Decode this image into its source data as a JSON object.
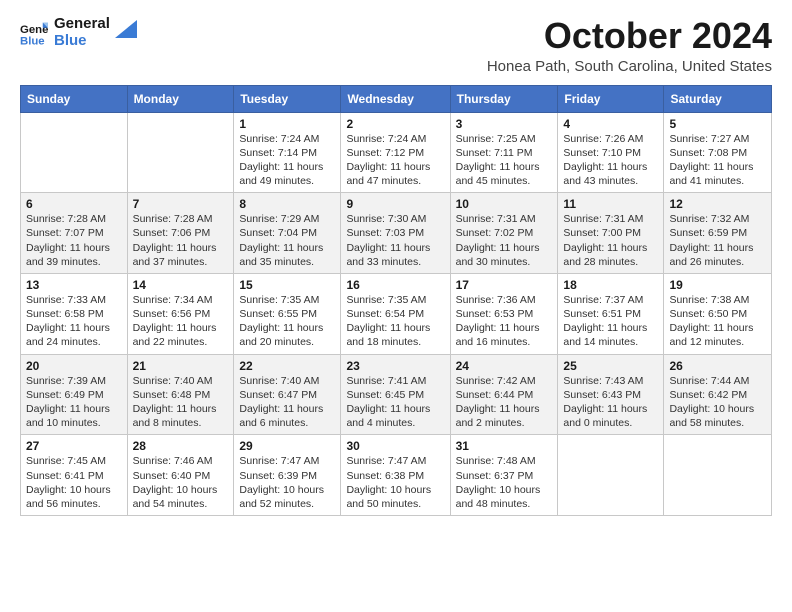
{
  "logo": {
    "line1": "General",
    "line2": "Blue"
  },
  "title": "October 2024",
  "location": "Honea Path, South Carolina, United States",
  "days_of_week": [
    "Sunday",
    "Monday",
    "Tuesday",
    "Wednesday",
    "Thursday",
    "Friday",
    "Saturday"
  ],
  "weeks": [
    [
      {
        "day": "",
        "info": ""
      },
      {
        "day": "",
        "info": ""
      },
      {
        "day": "1",
        "info": "Sunrise: 7:24 AM\nSunset: 7:14 PM\nDaylight: 11 hours and 49 minutes."
      },
      {
        "day": "2",
        "info": "Sunrise: 7:24 AM\nSunset: 7:12 PM\nDaylight: 11 hours and 47 minutes."
      },
      {
        "day": "3",
        "info": "Sunrise: 7:25 AM\nSunset: 7:11 PM\nDaylight: 11 hours and 45 minutes."
      },
      {
        "day": "4",
        "info": "Sunrise: 7:26 AM\nSunset: 7:10 PM\nDaylight: 11 hours and 43 minutes."
      },
      {
        "day": "5",
        "info": "Sunrise: 7:27 AM\nSunset: 7:08 PM\nDaylight: 11 hours and 41 minutes."
      }
    ],
    [
      {
        "day": "6",
        "info": "Sunrise: 7:28 AM\nSunset: 7:07 PM\nDaylight: 11 hours and 39 minutes."
      },
      {
        "day": "7",
        "info": "Sunrise: 7:28 AM\nSunset: 7:06 PM\nDaylight: 11 hours and 37 minutes."
      },
      {
        "day": "8",
        "info": "Sunrise: 7:29 AM\nSunset: 7:04 PM\nDaylight: 11 hours and 35 minutes."
      },
      {
        "day": "9",
        "info": "Sunrise: 7:30 AM\nSunset: 7:03 PM\nDaylight: 11 hours and 33 minutes."
      },
      {
        "day": "10",
        "info": "Sunrise: 7:31 AM\nSunset: 7:02 PM\nDaylight: 11 hours and 30 minutes."
      },
      {
        "day": "11",
        "info": "Sunrise: 7:31 AM\nSunset: 7:00 PM\nDaylight: 11 hours and 28 minutes."
      },
      {
        "day": "12",
        "info": "Sunrise: 7:32 AM\nSunset: 6:59 PM\nDaylight: 11 hours and 26 minutes."
      }
    ],
    [
      {
        "day": "13",
        "info": "Sunrise: 7:33 AM\nSunset: 6:58 PM\nDaylight: 11 hours and 24 minutes."
      },
      {
        "day": "14",
        "info": "Sunrise: 7:34 AM\nSunset: 6:56 PM\nDaylight: 11 hours and 22 minutes."
      },
      {
        "day": "15",
        "info": "Sunrise: 7:35 AM\nSunset: 6:55 PM\nDaylight: 11 hours and 20 minutes."
      },
      {
        "day": "16",
        "info": "Sunrise: 7:35 AM\nSunset: 6:54 PM\nDaylight: 11 hours and 18 minutes."
      },
      {
        "day": "17",
        "info": "Sunrise: 7:36 AM\nSunset: 6:53 PM\nDaylight: 11 hours and 16 minutes."
      },
      {
        "day": "18",
        "info": "Sunrise: 7:37 AM\nSunset: 6:51 PM\nDaylight: 11 hours and 14 minutes."
      },
      {
        "day": "19",
        "info": "Sunrise: 7:38 AM\nSunset: 6:50 PM\nDaylight: 11 hours and 12 minutes."
      }
    ],
    [
      {
        "day": "20",
        "info": "Sunrise: 7:39 AM\nSunset: 6:49 PM\nDaylight: 11 hours and 10 minutes."
      },
      {
        "day": "21",
        "info": "Sunrise: 7:40 AM\nSunset: 6:48 PM\nDaylight: 11 hours and 8 minutes."
      },
      {
        "day": "22",
        "info": "Sunrise: 7:40 AM\nSunset: 6:47 PM\nDaylight: 11 hours and 6 minutes."
      },
      {
        "day": "23",
        "info": "Sunrise: 7:41 AM\nSunset: 6:45 PM\nDaylight: 11 hours and 4 minutes."
      },
      {
        "day": "24",
        "info": "Sunrise: 7:42 AM\nSunset: 6:44 PM\nDaylight: 11 hours and 2 minutes."
      },
      {
        "day": "25",
        "info": "Sunrise: 7:43 AM\nSunset: 6:43 PM\nDaylight: 11 hours and 0 minutes."
      },
      {
        "day": "26",
        "info": "Sunrise: 7:44 AM\nSunset: 6:42 PM\nDaylight: 10 hours and 58 minutes."
      }
    ],
    [
      {
        "day": "27",
        "info": "Sunrise: 7:45 AM\nSunset: 6:41 PM\nDaylight: 10 hours and 56 minutes."
      },
      {
        "day": "28",
        "info": "Sunrise: 7:46 AM\nSunset: 6:40 PM\nDaylight: 10 hours and 54 minutes."
      },
      {
        "day": "29",
        "info": "Sunrise: 7:47 AM\nSunset: 6:39 PM\nDaylight: 10 hours and 52 minutes."
      },
      {
        "day": "30",
        "info": "Sunrise: 7:47 AM\nSunset: 6:38 PM\nDaylight: 10 hours and 50 minutes."
      },
      {
        "day": "31",
        "info": "Sunrise: 7:48 AM\nSunset: 6:37 PM\nDaylight: 10 hours and 48 minutes."
      },
      {
        "day": "",
        "info": ""
      },
      {
        "day": "",
        "info": ""
      }
    ]
  ]
}
